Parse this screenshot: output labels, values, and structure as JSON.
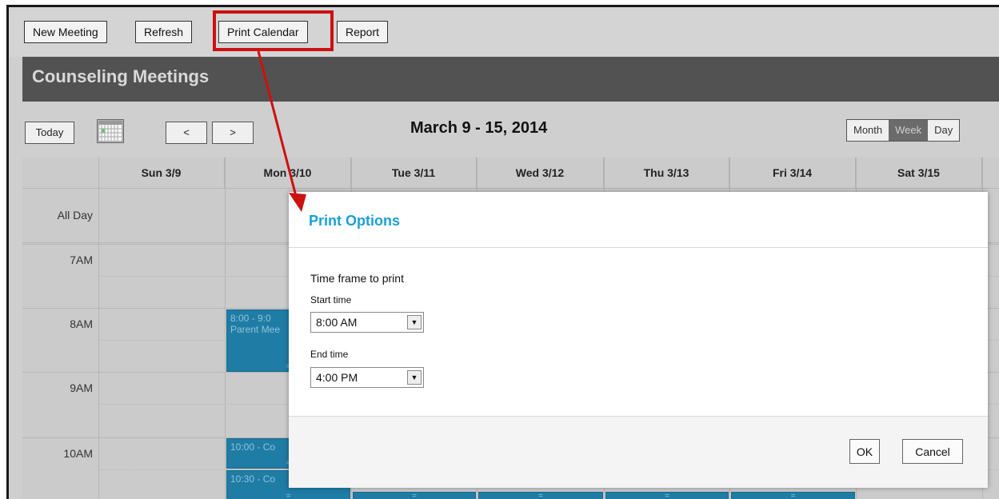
{
  "toolbar": {
    "new_meeting": "New Meeting",
    "refresh": "Refresh",
    "print_calendar": "Print Calendar",
    "report": "Report"
  },
  "calendar": {
    "title": "Counseling Meetings",
    "today": "Today",
    "prev": "<",
    "next": ">",
    "range": "March 9 - 15, 2014",
    "views": {
      "month": "Month",
      "week": "Week",
      "day": "Day",
      "active": "Week"
    },
    "days": [
      "Sun 3/9",
      "Mon 3/10",
      "Tue 3/11",
      "Wed 3/12",
      "Thu 3/13",
      "Fri 3/14",
      "Sat 3/15"
    ],
    "all_day": "All Day",
    "times": [
      "7AM",
      "8AM",
      "9AM",
      "10AM"
    ],
    "events": [
      {
        "time": "8:00 - 9:0",
        "title": "Parent Mee"
      },
      {
        "time": "10:00 - Co",
        "title": ""
      },
      {
        "time": "10:30 - Co",
        "title": ""
      }
    ]
  },
  "dialog": {
    "title": "Print Options",
    "section": "Time frame to print",
    "start_label": "Start time",
    "start_value": "8:00 AM",
    "end_label": "End time",
    "end_value": "4:00 PM",
    "ok": "OK",
    "cancel": "Cancel"
  },
  "colors": {
    "highlight": "#cc1111",
    "dialog_title": "#1aa0d8",
    "event_bg": "#1f7ca5",
    "header_bar": "#525252"
  }
}
